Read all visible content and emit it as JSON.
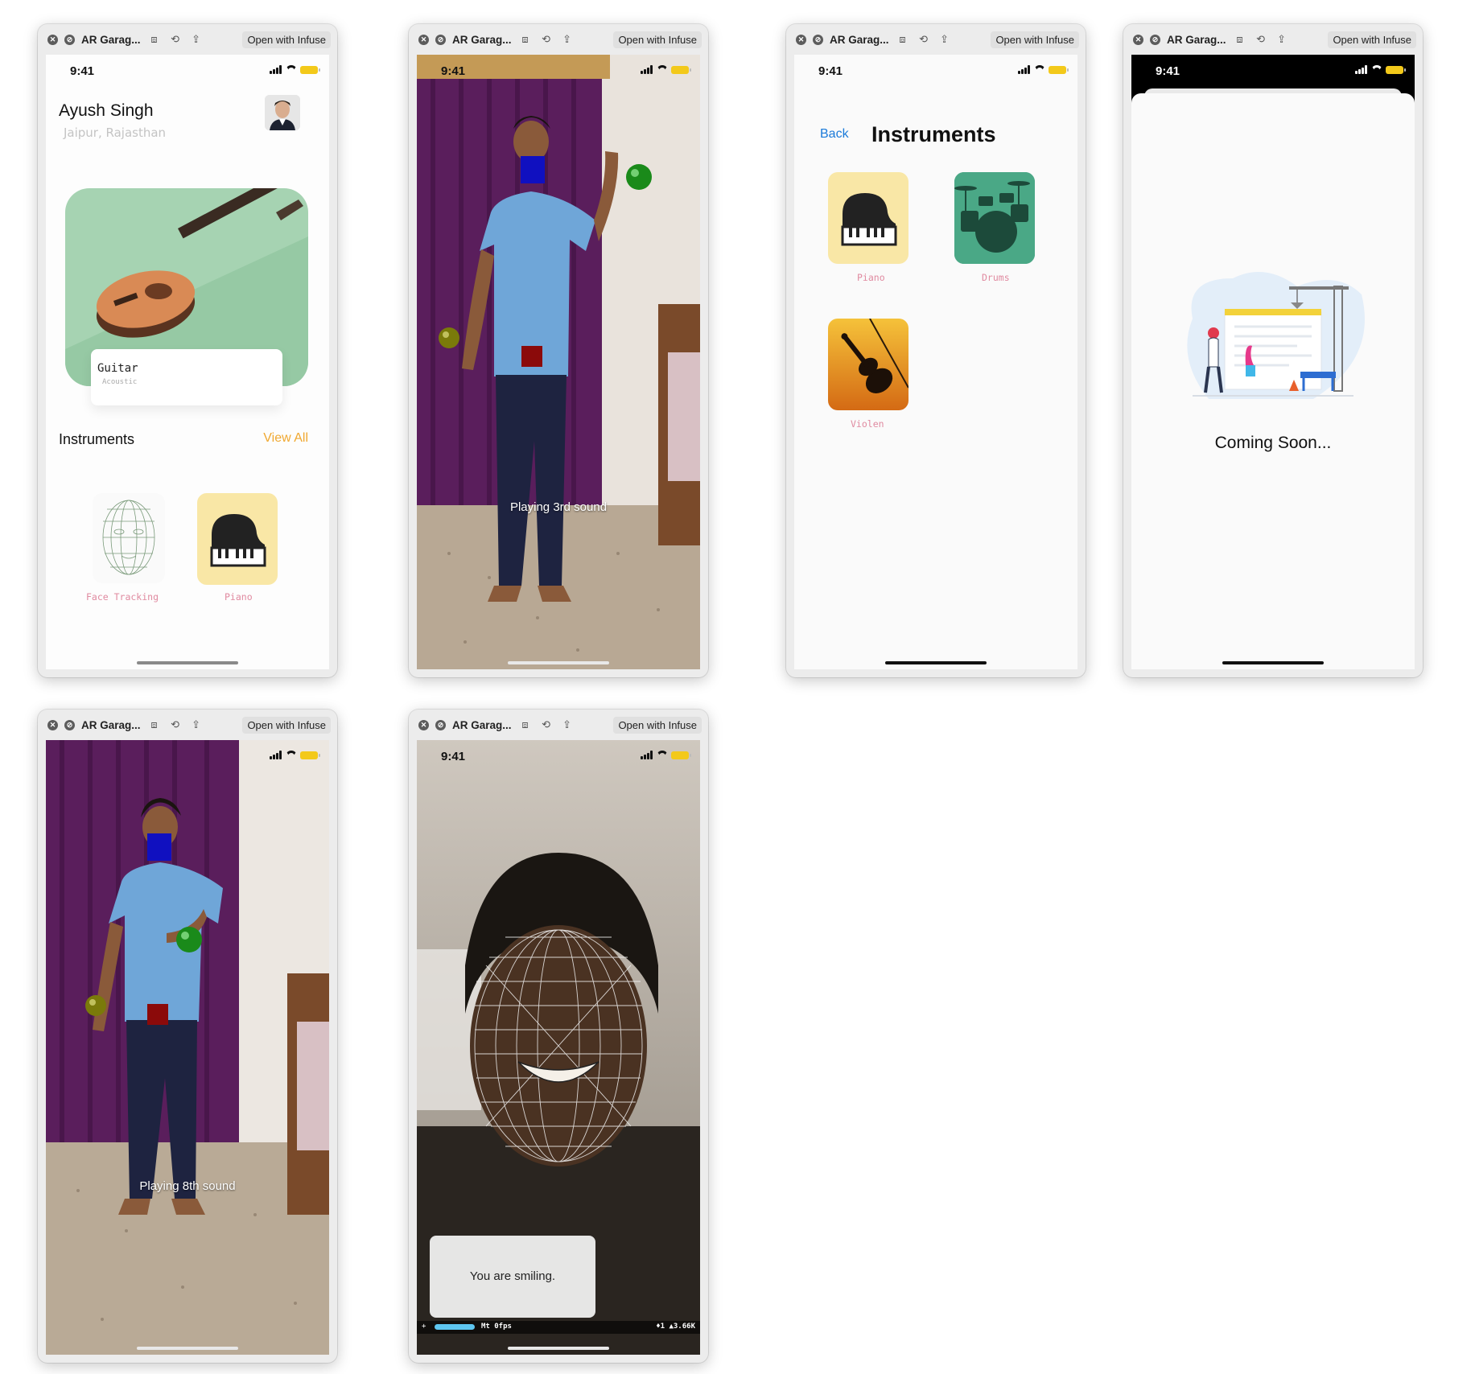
{
  "window": {
    "title": "AR Garag...",
    "open_with": "Open with Infuse"
  },
  "status": {
    "time": "9:41"
  },
  "home": {
    "user_name": "Ayush Singh",
    "user_location": "Jaipur, Rajasthan",
    "featured": {
      "title": "Guitar",
      "subtitle": "Acoustic"
    },
    "section_title": "Instruments",
    "view_all": "View All",
    "items": [
      {
        "label": "Face Tracking",
        "icon": "face-mesh-icon"
      },
      {
        "label": "Piano",
        "icon": "piano-icon"
      }
    ]
  },
  "ar_body_1": {
    "caption": "Playing 3rd sound"
  },
  "instruments": {
    "back": "Back",
    "title": "Instruments",
    "items": [
      {
        "label": "Piano",
        "icon": "piano-icon"
      },
      {
        "label": "Drums",
        "icon": "drums-icon"
      },
      {
        "label": "Violen",
        "icon": "violin-icon"
      }
    ]
  },
  "coming_soon": {
    "text": "Coming Soon..."
  },
  "ar_body_2": {
    "caption": "Playing 8th sound"
  },
  "face": {
    "message": "You are smiling.",
    "stats_left": "Mt 0fps",
    "stats_right": "♦1 ▲3.66K"
  },
  "colors": {
    "accent_orange": "#f0a830",
    "link_blue": "#1a7ad9",
    "label_pink": "#e08aa0"
  }
}
